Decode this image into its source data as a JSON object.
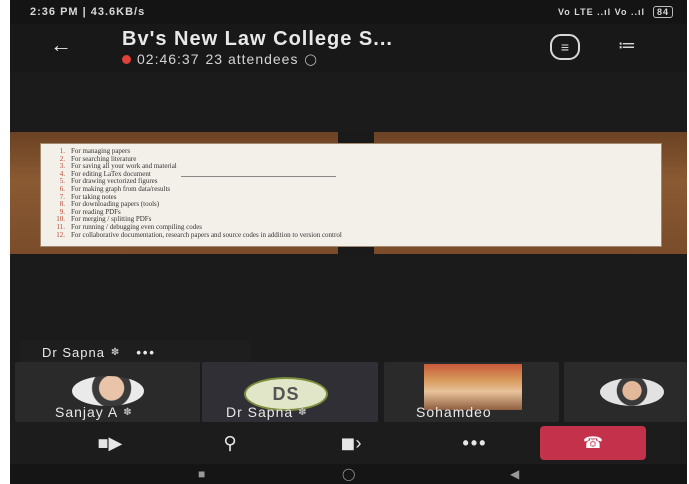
{
  "status_bar": {
    "time": "2:36 PM | 43.6KB/s",
    "right_text": "Vo LTE ..ıl Vo ..ıl",
    "battery": "84"
  },
  "header": {
    "back_icon": "arrow-left-icon",
    "title": "Bv's New Law College S...",
    "duration": "02:46:37",
    "attendees": "23 attendees"
  },
  "slide": {
    "lines": [
      {
        "n": "1.",
        "t": "For managing papers"
      },
      {
        "n": "2.",
        "t": "For searching literature"
      },
      {
        "n": "3.",
        "t": "For saving all your work and material"
      },
      {
        "n": "4.",
        "t": "For editing LaTex document"
      },
      {
        "n": "5.",
        "t": "For drawing vectorized figures"
      },
      {
        "n": "6.",
        "t": "For making graph from data/results"
      },
      {
        "n": "7.",
        "t": "For taking notes"
      },
      {
        "n": "8.",
        "t": "For downloading papers (tools)"
      },
      {
        "n": "9.",
        "t": "For reading PDFs"
      },
      {
        "n": "10.",
        "t": "For merging / splitting PDFs"
      },
      {
        "n": "11.",
        "t": "For running / debugging even compiling codes"
      },
      {
        "n": "12.",
        "t": "For collaborative documentation, research papers and source codes in addition to version control"
      }
    ]
  },
  "presenter": {
    "name": "Dr Sapna",
    "more": "•••"
  },
  "participants": [
    {
      "name": "Sanjay A"
    },
    {
      "name": "Dr Sapna",
      "initials": "DS"
    },
    {
      "name": "Sohamdeo"
    },
    {
      "name": ""
    }
  ],
  "controls": {
    "camera": "camera-off-icon",
    "mic": "mic-off-icon",
    "speaker": "speaker-icon",
    "more": "•••",
    "end": "hang-up-icon"
  },
  "colors": {
    "end_call": "#c4314b",
    "recording": "#e0403a",
    "initials_bg": "#e2e6c9"
  }
}
